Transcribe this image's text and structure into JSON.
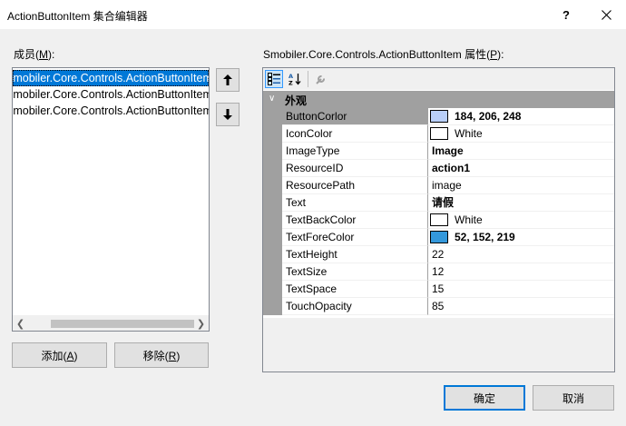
{
  "window": {
    "title": "ActionButtonItem 集合编辑器",
    "help_label": "?"
  },
  "members": {
    "label_prefix": "成员(",
    "label_key": "M",
    "label_suffix": "):",
    "items": [
      {
        "text": "Smobiler.Core.Controls.ActionButtonItem",
        "selected": true
      },
      {
        "text": "Smobiler.Core.Controls.ActionButtonItem",
        "selected": false
      },
      {
        "text": "Smobiler.Core.Controls.ActionButtonItem",
        "selected": false
      }
    ],
    "add_prefix": "添加(",
    "add_key": "A",
    "add_suffix": ")",
    "remove_prefix": "移除(",
    "remove_key": "R",
    "remove_suffix": ")"
  },
  "properties": {
    "label_prefix": "Smobiler.Core.Controls.ActionButtonItem 属性(",
    "label_key": "P",
    "label_suffix": "):",
    "category": "外观",
    "rows": [
      {
        "name": "ButtonCorlor",
        "value": "184, 206, 248",
        "swatch": "#b8cef8",
        "bold": true,
        "selected": true
      },
      {
        "name": "IconColor",
        "value": "White",
        "swatch": "#ffffff",
        "bold": false,
        "selected": false
      },
      {
        "name": "ImageType",
        "value": "Image",
        "swatch": null,
        "bold": true,
        "selected": false
      },
      {
        "name": "ResourceID",
        "value": "action1",
        "swatch": null,
        "bold": true,
        "selected": false
      },
      {
        "name": "ResourcePath",
        "value": "image",
        "swatch": null,
        "bold": false,
        "selected": false
      },
      {
        "name": "Text",
        "value": "请假",
        "swatch": null,
        "bold": true,
        "selected": false
      },
      {
        "name": "TextBackColor",
        "value": "White",
        "swatch": "#ffffff",
        "bold": false,
        "selected": false
      },
      {
        "name": "TextForeColor",
        "value": "52, 152, 219",
        "swatch": "#3498db",
        "bold": true,
        "selected": false
      },
      {
        "name": "TextHeight",
        "value": "22",
        "swatch": null,
        "bold": false,
        "selected": false
      },
      {
        "name": "TextSize",
        "value": "12",
        "swatch": null,
        "bold": false,
        "selected": false
      },
      {
        "name": "TextSpace",
        "value": "15",
        "swatch": null,
        "bold": false,
        "selected": false
      },
      {
        "name": "TouchOpacity",
        "value": "85",
        "swatch": null,
        "bold": false,
        "selected": false
      }
    ]
  },
  "footer": {
    "ok_label": "确定",
    "cancel_label": "取消"
  },
  "colors": {
    "selection": "#0078d7",
    "grid_line": "#a0a0a0",
    "dialog_bg": "#f0f0f0"
  },
  "icons": {
    "close": "close-icon",
    "help": "help-icon",
    "up": "arrow-up-icon",
    "down": "arrow-down-icon",
    "categorized": "categorized-icon",
    "alphabetical": "sort-alpha-icon",
    "property_pages": "wrench-icon",
    "collapse": "collapse-icon"
  }
}
